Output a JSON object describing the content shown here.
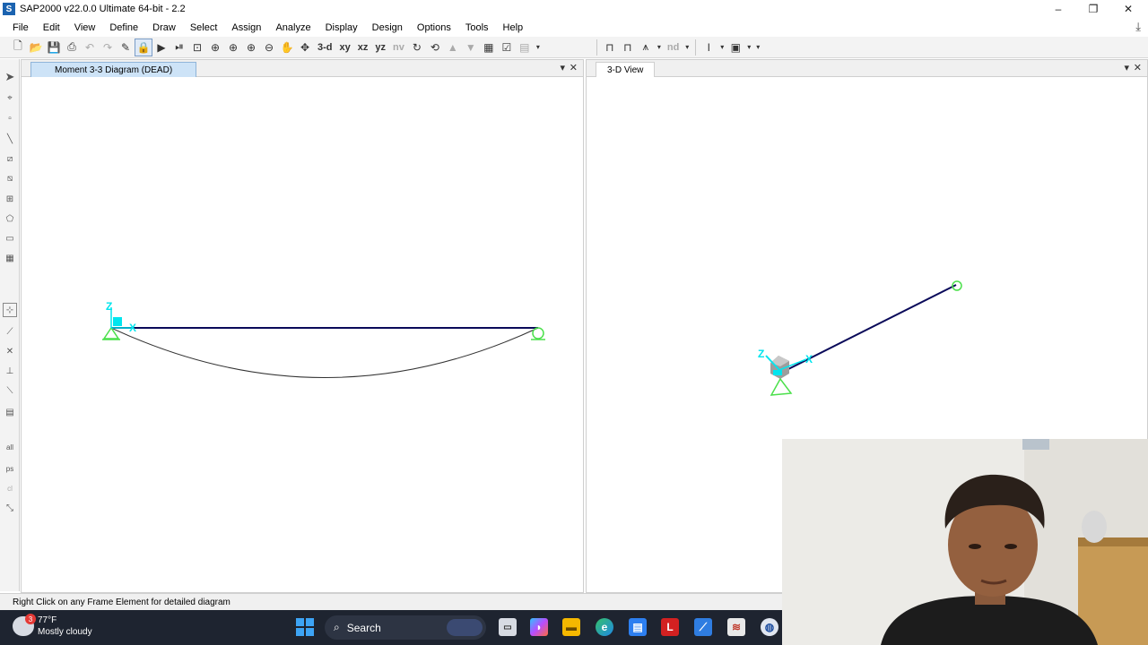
{
  "window": {
    "title": "SAP2000 v22.0.0 Ultimate 64-bit - 2.2",
    "app_icon_letter": "S"
  },
  "menu": [
    "File",
    "Edit",
    "View",
    "Define",
    "Draw",
    "Select",
    "Assign",
    "Analyze",
    "Display",
    "Design",
    "Options",
    "Tools",
    "Help"
  ],
  "toolbar": {
    "view_3d": "3-d",
    "view_xy": "xy",
    "view_xz": "xz",
    "view_yz": "yz",
    "view_nv": "nv",
    "nd_label": "nd"
  },
  "panes": {
    "left": {
      "title": "Moment 3-3 Diagram (DEAD)"
    },
    "right": {
      "title": "3-D View"
    }
  },
  "axes": {
    "z": "Z",
    "x": "X"
  },
  "status": {
    "message": "Right Click on any Frame Element for detailed diagram"
  },
  "taskbar": {
    "weather_temp": "77°F",
    "weather_desc": "Mostly cloudy",
    "weather_badge": "3",
    "search_label": "Search",
    "pinned_letter": "L"
  },
  "colors": {
    "frame": "#0a0a5a",
    "axis": "#00e5ee",
    "support": "#4be04b",
    "moment_curve": "#333333",
    "tab_active": "#cde3f7"
  }
}
